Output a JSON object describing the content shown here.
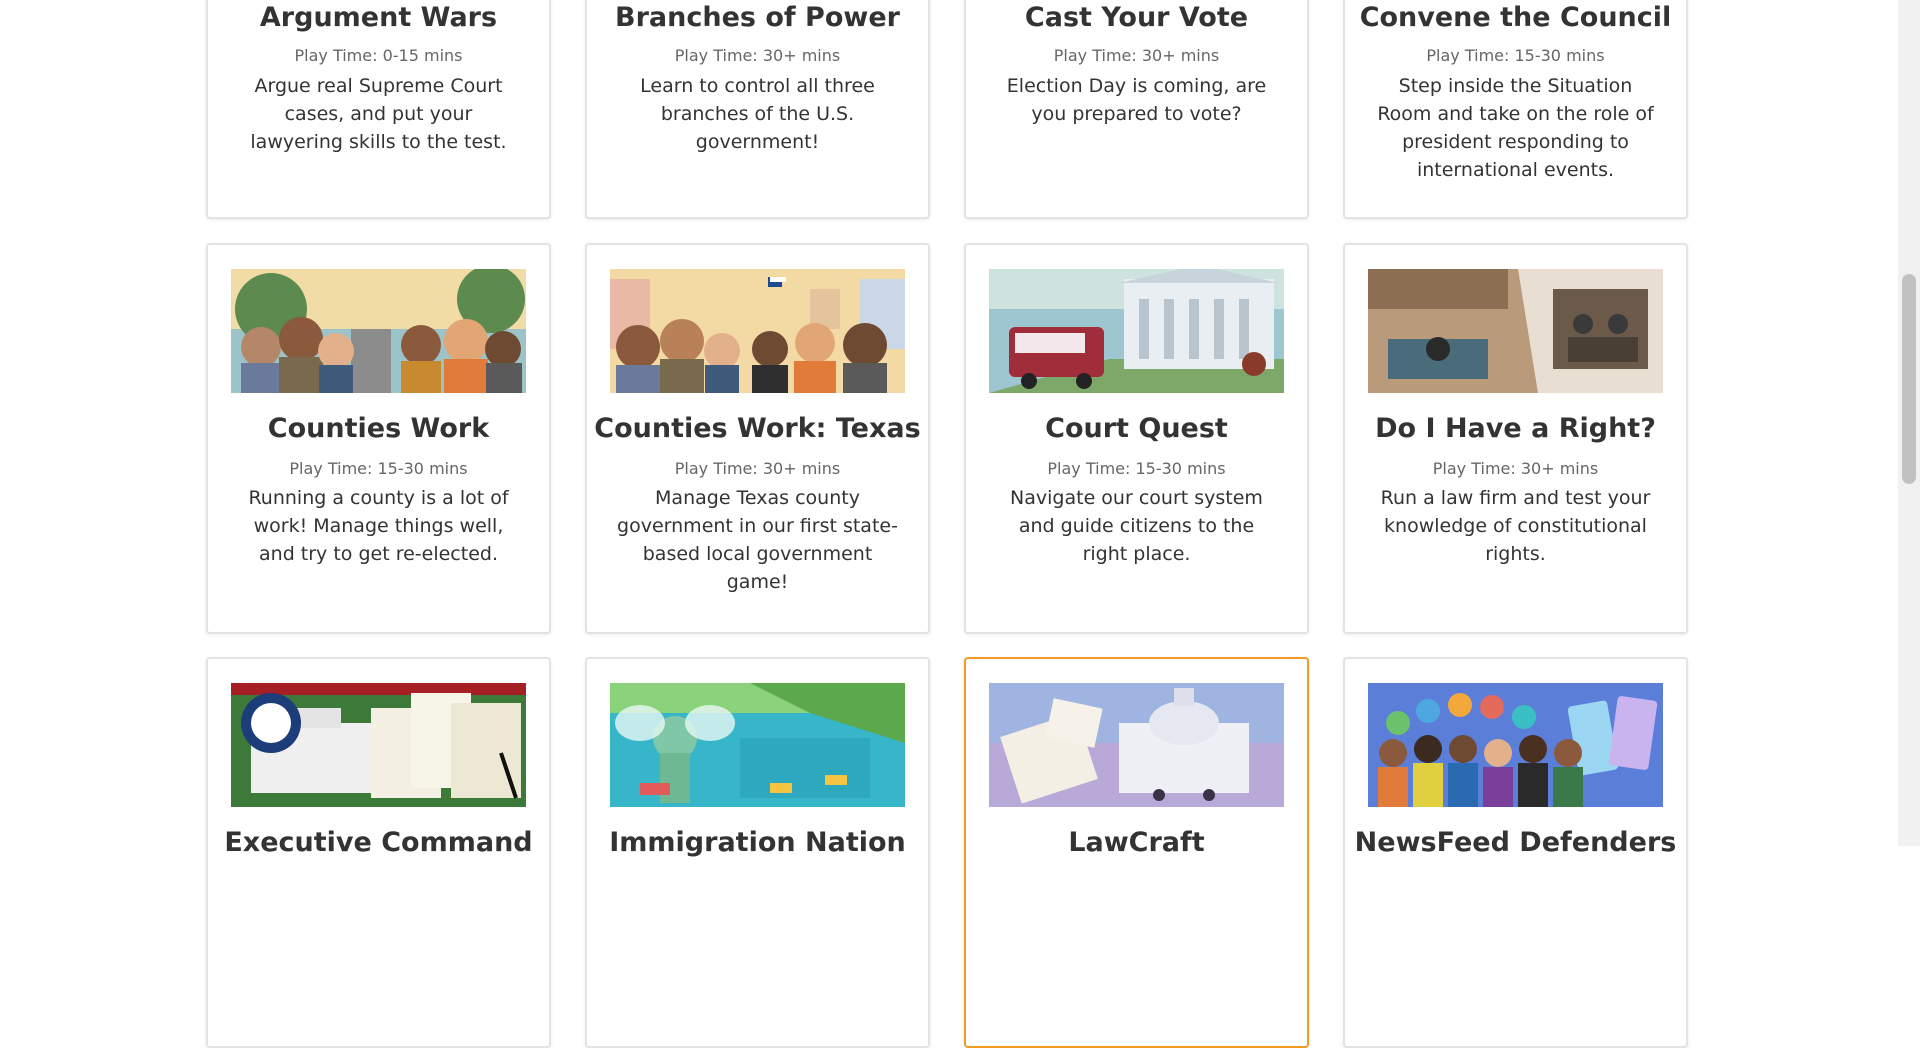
{
  "cards": [
    {
      "title": "Argument Wars",
      "playtime": "Play Time: 0-15 mins",
      "description": "Argue real Supreme Court cases, and put your lawyering skills to the test."
    },
    {
      "title": "Branches of Power",
      "playtime": "Play Time: 30+ mins",
      "description": "Learn to control all three branches of the U.S. government!"
    },
    {
      "title": "Cast Your Vote",
      "playtime": "Play Time: 30+ mins",
      "description": "Election Day is coming, are you prepared to vote?"
    },
    {
      "title": "Convene the Council",
      "playtime": "Play Time: 15-30 mins",
      "description": "Step inside the Situation Room and take on the role of president responding to international events."
    },
    {
      "title": "Counties Work",
      "playtime": "Play Time: 15-30 mins",
      "description": "Running a county is a lot of work! Manage things well, and try to get re-elected.",
      "image": "counties-work-game-art"
    },
    {
      "title": "Counties Work: Texas",
      "playtime": "Play Time: 30+ mins",
      "description": "Manage Texas county government in our first state-based local government game!",
      "image": "counties-work-texas-game-art"
    },
    {
      "title": "Court Quest",
      "playtime": "Play Time: 15-30 mins",
      "description": "Navigate our court system and guide citizens to the right place.",
      "image": "court-quest-game-art"
    },
    {
      "title": "Do I Have a Right?",
      "playtime": "Play Time: 30+ mins",
      "description": "Run a law firm and test your knowledge of constitutional rights.",
      "image": "do-i-have-a-right-game-art"
    },
    {
      "title": "Executive Command",
      "image": "executive-command-game-art"
    },
    {
      "title": "Immigration Nation",
      "image": "immigration-nation-game-art"
    },
    {
      "title": "LawCraft",
      "image": "lawcraft-game-art",
      "highlighted": true
    },
    {
      "title": "NewsFeed Defenders",
      "image": "newsfeed-defenders-game-art"
    }
  ],
  "colors": {
    "highlight_border": "#f29a22",
    "card_border": "#e3e3e3",
    "title": "#333333",
    "meta": "#666666"
  }
}
